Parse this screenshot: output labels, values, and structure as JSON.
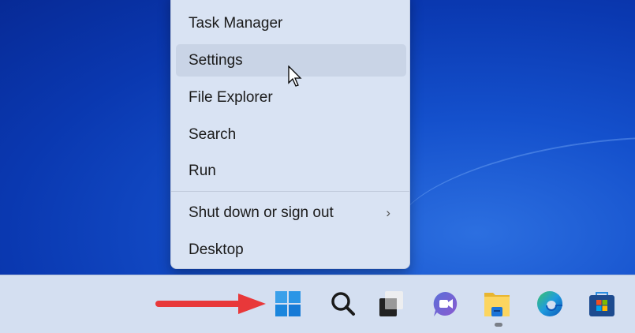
{
  "context_menu": {
    "items": [
      {
        "label": "Task Manager"
      },
      {
        "label": "Settings",
        "hovered": true
      },
      {
        "label": "File Explorer"
      },
      {
        "label": "Search"
      },
      {
        "label": "Run"
      },
      {
        "label": "Shut down or sign out",
        "submenu": true
      },
      {
        "label": "Desktop"
      }
    ]
  },
  "taskbar": {
    "icons": [
      "windows-start-icon",
      "search-icon",
      "task-view-icon",
      "teams-chat-icon",
      "file-explorer-icon",
      "edge-icon",
      "store-icon"
    ],
    "running_app": "file-explorer"
  },
  "colors": {
    "arrow": "#e8383a",
    "menu_bg": "#d9e3f3",
    "taskbar_bg": "#d4dff1"
  }
}
